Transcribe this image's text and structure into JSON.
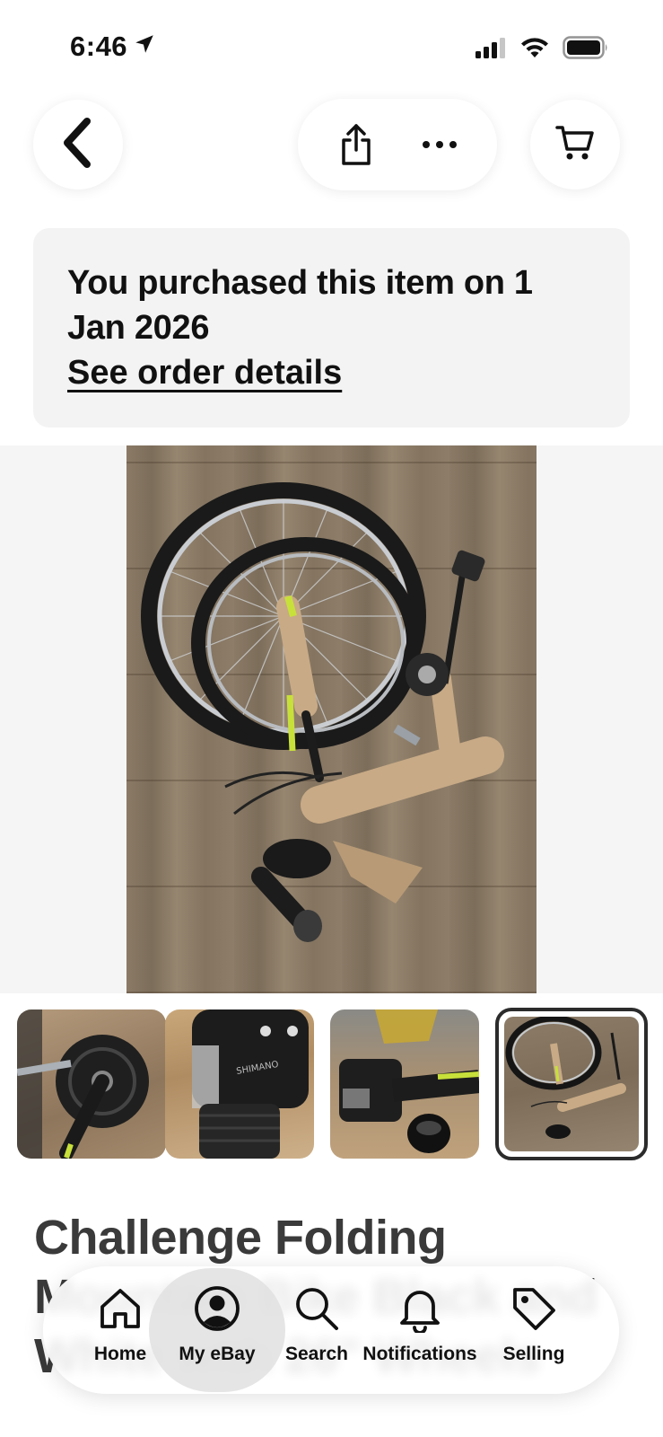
{
  "status_bar": {
    "time": "6:46",
    "icons": [
      "location-arrow-icon",
      "cellular-signal-icon",
      "wifi-icon",
      "battery-icon"
    ]
  },
  "top_nav": {
    "back_icon": "chevron-left-icon",
    "share_icon": "share-icon",
    "more_icon": "more-horizontal-icon",
    "cart_icon": "cart-icon"
  },
  "banner": {
    "message": "You purchased this item on 1 Jan 2026",
    "link_label": "See order details"
  },
  "gallery": {
    "main_image": "folded bicycle on wooden floor",
    "thumbnails": [
      {
        "label": "crankset close-up"
      },
      {
        "label": "shimano grip shifter"
      },
      {
        "label": "handlebar shifter and bell"
      },
      {
        "label": "folded bicycle",
        "selected": true
      }
    ],
    "thumb_text": {
      "shifter_brand": "SHIMANO"
    }
  },
  "item": {
    "title": "Challenge Folding Mountain Bike Black and White with 26\" Wheels"
  },
  "tab_bar": {
    "items": [
      {
        "label": "Home",
        "icon": "home-icon",
        "active": false
      },
      {
        "label": "My eBay",
        "icon": "user-circle-icon",
        "active": true
      },
      {
        "label": "Search",
        "icon": "search-icon",
        "active": false
      },
      {
        "label": "Notifications",
        "icon": "bell-icon",
        "active": false
      },
      {
        "label": "Selling",
        "icon": "tag-icon",
        "active": false
      }
    ]
  }
}
